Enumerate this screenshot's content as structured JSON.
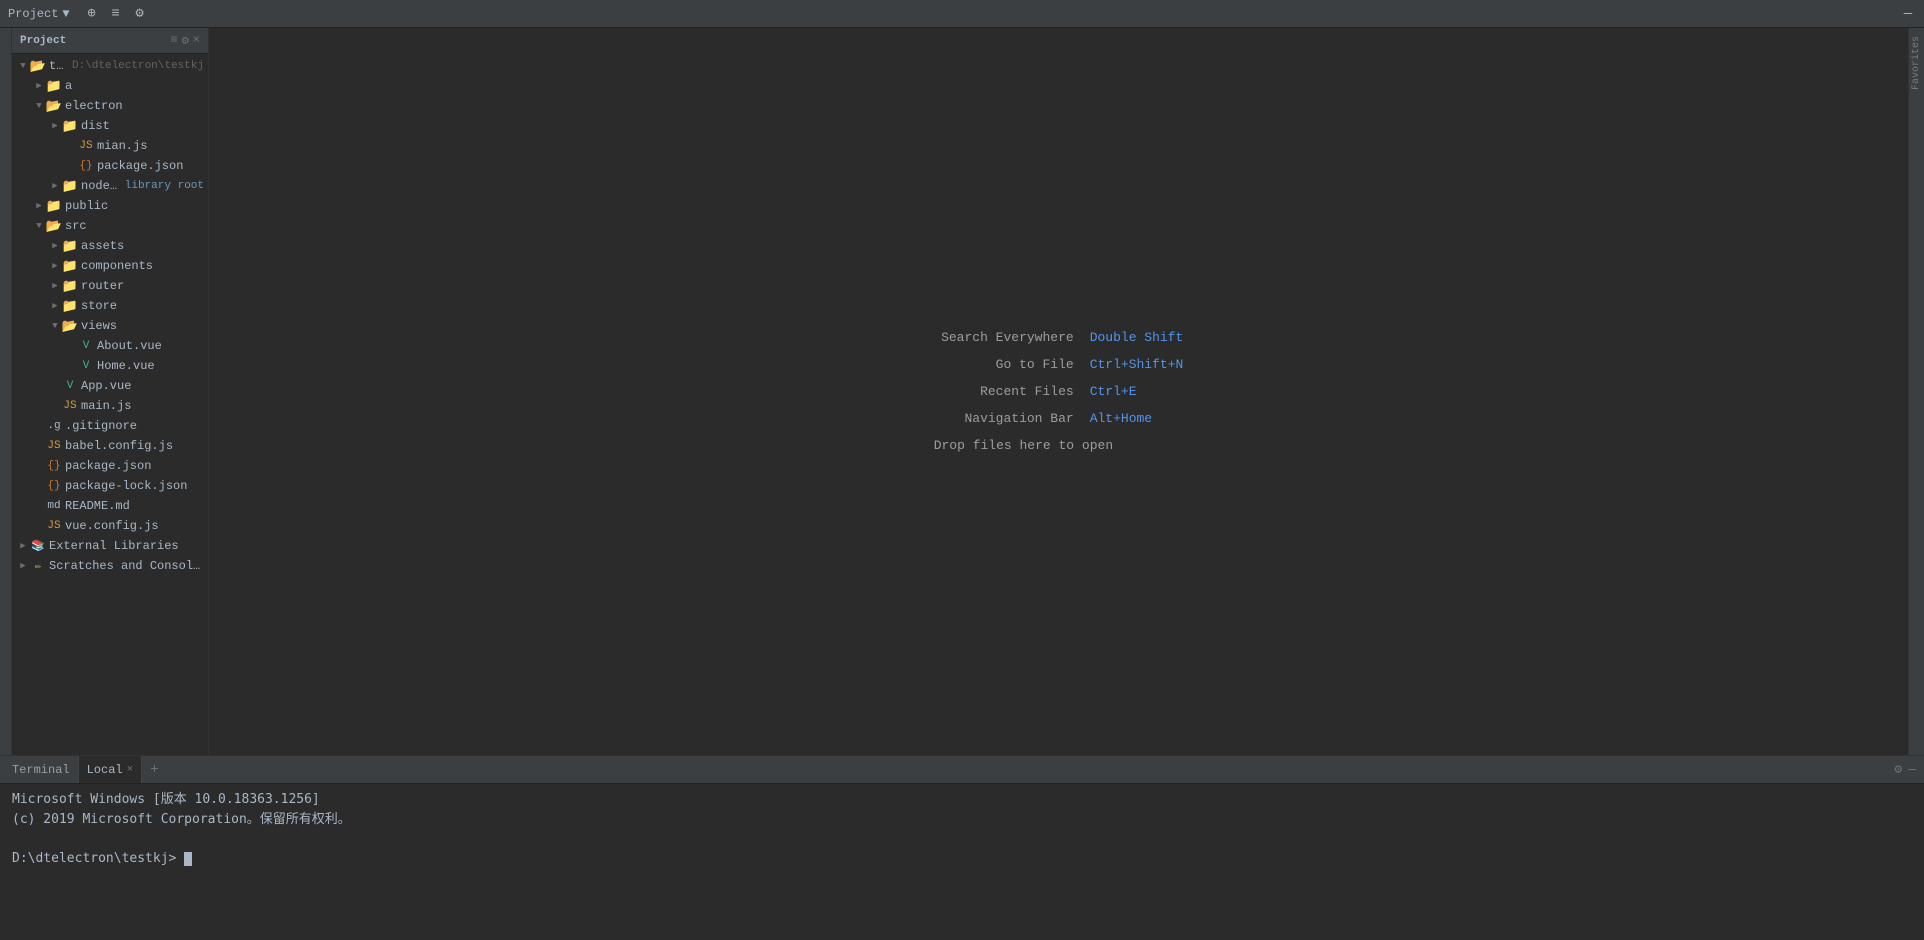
{
  "titleBar": {
    "projectLabel": "Project",
    "dropdownIcon": "▼",
    "icons": [
      "⊕",
      "≡",
      "⚙",
      "—"
    ]
  },
  "projectPanel": {
    "title": "Project",
    "rootLabel": "testkj",
    "rootPath": "D:\\dtelectron\\testkj",
    "tree": [
      {
        "id": "testkj",
        "indent": 0,
        "arrow": "open",
        "icon": "folder-open",
        "label": "testkj",
        "secondary": "D:\\dtelectron\\testkj",
        "tag": ""
      },
      {
        "id": "a",
        "indent": 1,
        "arrow": "closed",
        "icon": "folder",
        "label": "a",
        "secondary": "",
        "tag": ""
      },
      {
        "id": "electron",
        "indent": 1,
        "arrow": "open",
        "icon": "folder-open",
        "label": "electron",
        "secondary": "",
        "tag": ""
      },
      {
        "id": "dist",
        "indent": 2,
        "arrow": "closed",
        "icon": "folder",
        "label": "dist",
        "secondary": "",
        "tag": ""
      },
      {
        "id": "mian.js",
        "indent": 3,
        "arrow": "leaf",
        "icon": "file-js",
        "label": "mian.js",
        "secondary": "",
        "tag": ""
      },
      {
        "id": "package.json-e",
        "indent": 3,
        "arrow": "leaf",
        "icon": "file-json",
        "label": "package.json",
        "secondary": "",
        "tag": ""
      },
      {
        "id": "node_modules",
        "indent": 2,
        "arrow": "closed",
        "icon": "folder",
        "label": "node_modules",
        "secondary": "",
        "tag": "library root"
      },
      {
        "id": "public",
        "indent": 1,
        "arrow": "closed",
        "icon": "folder",
        "label": "public",
        "secondary": "",
        "tag": ""
      },
      {
        "id": "src",
        "indent": 1,
        "arrow": "open",
        "icon": "folder-open",
        "label": "src",
        "secondary": "",
        "tag": ""
      },
      {
        "id": "assets",
        "indent": 2,
        "arrow": "closed",
        "icon": "folder",
        "label": "assets",
        "secondary": "",
        "tag": ""
      },
      {
        "id": "components",
        "indent": 2,
        "arrow": "closed",
        "icon": "folder",
        "label": "components",
        "secondary": "",
        "tag": ""
      },
      {
        "id": "router",
        "indent": 2,
        "arrow": "closed",
        "icon": "folder",
        "label": "router",
        "secondary": "",
        "tag": ""
      },
      {
        "id": "store",
        "indent": 2,
        "arrow": "closed",
        "icon": "folder",
        "label": "store",
        "secondary": "",
        "tag": ""
      },
      {
        "id": "views",
        "indent": 2,
        "arrow": "open",
        "icon": "folder-open",
        "label": "views",
        "secondary": "",
        "tag": ""
      },
      {
        "id": "About.vue",
        "indent": 3,
        "arrow": "leaf",
        "icon": "file-vue",
        "label": "About.vue",
        "secondary": "",
        "tag": ""
      },
      {
        "id": "Home.vue",
        "indent": 3,
        "arrow": "leaf",
        "icon": "file-vue",
        "label": "Home.vue",
        "secondary": "",
        "tag": ""
      },
      {
        "id": "App.vue",
        "indent": 2,
        "arrow": "leaf",
        "icon": "file-vue",
        "label": "App.vue",
        "secondary": "",
        "tag": ""
      },
      {
        "id": "main.js",
        "indent": 2,
        "arrow": "leaf",
        "icon": "file-js",
        "label": "main.js",
        "secondary": "",
        "tag": ""
      },
      {
        "id": ".gitignore",
        "indent": 1,
        "arrow": "leaf",
        "icon": "file-git",
        "label": ".gitignore",
        "secondary": "",
        "tag": ""
      },
      {
        "id": "babel.config.js",
        "indent": 1,
        "arrow": "leaf",
        "icon": "file-js",
        "label": "babel.config.js",
        "secondary": "",
        "tag": ""
      },
      {
        "id": "package.json",
        "indent": 1,
        "arrow": "leaf",
        "icon": "file-json",
        "label": "package.json",
        "secondary": "",
        "tag": ""
      },
      {
        "id": "package-lock.json",
        "indent": 1,
        "arrow": "leaf",
        "icon": "file-json",
        "label": "package-lock.json",
        "secondary": "",
        "tag": ""
      },
      {
        "id": "README.md",
        "indent": 1,
        "arrow": "leaf",
        "icon": "file-md",
        "label": "README.md",
        "secondary": "",
        "tag": ""
      },
      {
        "id": "vue.config.js",
        "indent": 1,
        "arrow": "leaf",
        "icon": "file-js",
        "label": "vue.config.js",
        "secondary": "",
        "tag": ""
      },
      {
        "id": "ExternalLibraries",
        "indent": 0,
        "arrow": "closed",
        "icon": "external-lib",
        "label": "External Libraries",
        "secondary": "",
        "tag": ""
      },
      {
        "id": "Scratches",
        "indent": 0,
        "arrow": "closed",
        "icon": "scratches",
        "label": "Scratches and Consoles",
        "secondary": "",
        "tag": ""
      }
    ]
  },
  "editor": {
    "searchEverywhereLabel": "Search Everywhere",
    "searchEverywhereShortcut": "Double Shift",
    "goToFileLabel": "Go to File",
    "goToFileShortcut": "Ctrl+Shift+N",
    "recentFilesLabel": "Recent Files",
    "recentFilesShortcut": "Ctrl+E",
    "navigationBarLabel": "Navigation Bar",
    "navigationBarShortcut": "Alt+Home",
    "dropFilesLabel": "Drop files here to open"
  },
  "terminal": {
    "title": "Terminal",
    "tabLabel": "Local",
    "line1": "Microsoft Windows [版本 10.0.18363.1256]",
    "line2": "(c) 2019 Microsoft Corporation。保留所有权利。",
    "line3": "",
    "prompt": "D:\\dtelectron\\testkj>"
  },
  "rightStrip": {
    "label": "Favorites"
  },
  "icons": {
    "folder": "📁",
    "folderOpen": "📂",
    "fileJs": "JS",
    "fileJson": "{}",
    "fileVue": "V",
    "fileGit": ".g",
    "fileMd": "md",
    "externalLib": "📚",
    "scratches": "✏"
  }
}
